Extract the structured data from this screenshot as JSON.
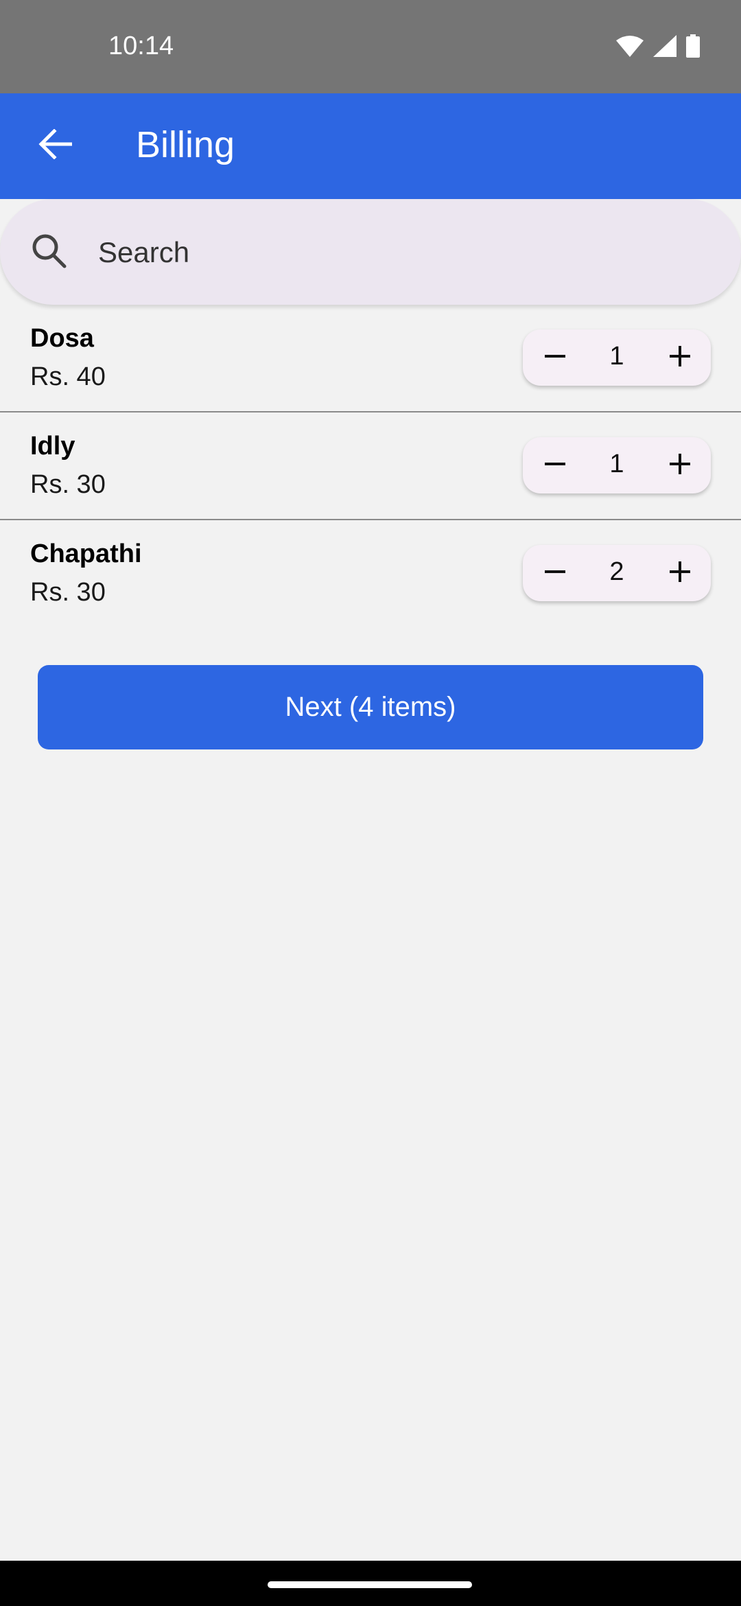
{
  "status_bar": {
    "time": "10:14",
    "icons": [
      "wifi-icon",
      "cellular-signal-icon",
      "battery-icon"
    ]
  },
  "app_bar": {
    "title": "Billing",
    "back_icon": "arrow-left-icon",
    "color": "#2d66e2"
  },
  "search": {
    "placeholder": "Search",
    "icon": "search-icon"
  },
  "items": [
    {
      "name": "Dosa",
      "price": "Rs. 40",
      "quantity": "1"
    },
    {
      "name": "Idly",
      "price": "Rs. 30",
      "quantity": "1"
    },
    {
      "name": "Chapathi",
      "price": "Rs. 30",
      "quantity": "2"
    }
  ],
  "next_button": {
    "label": "Next (4 items)"
  }
}
